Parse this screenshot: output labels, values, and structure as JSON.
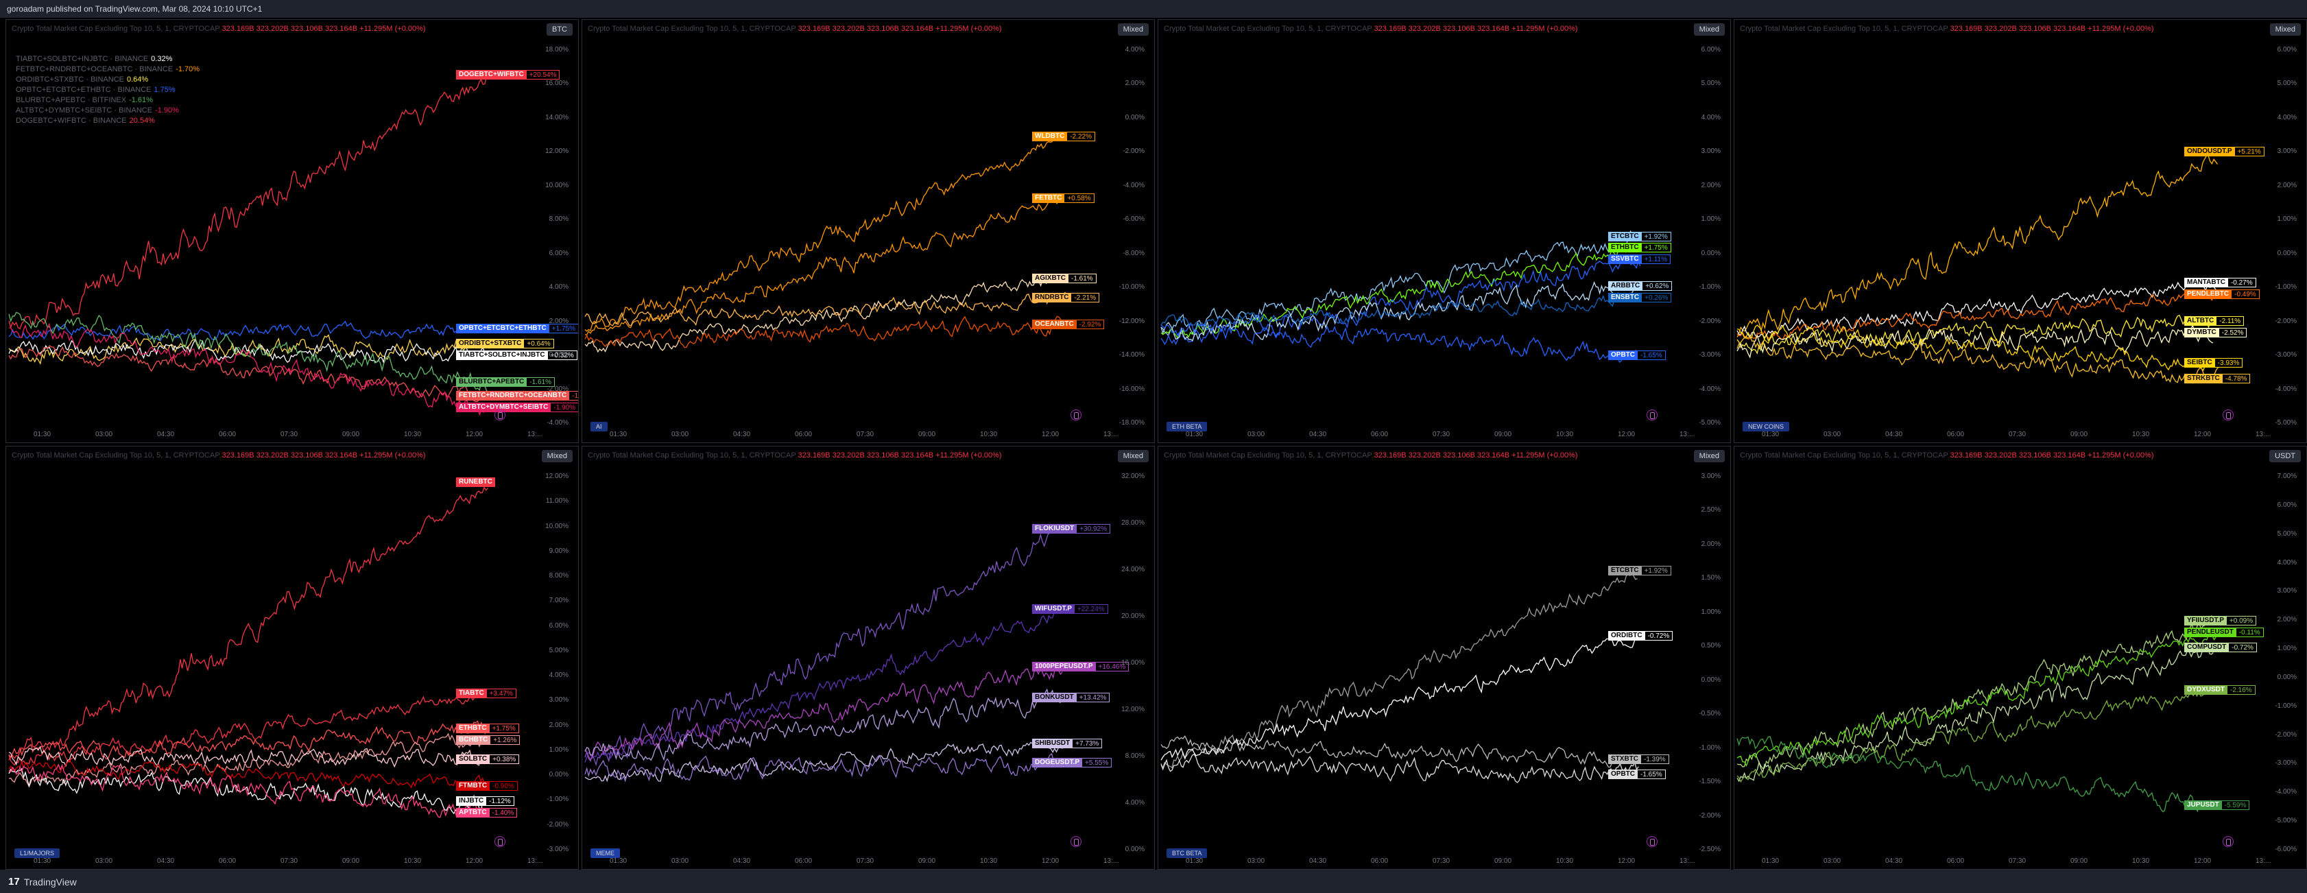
{
  "header": {
    "published": "goroadam published on TradingView.com, Mar 08, 2024 10:10 UTC+1"
  },
  "footer": {
    "brand_logo": "17",
    "brand": "TradingView"
  },
  "panel_title": "Crypto Total Market Cap Excluding Top 10, 5, 1, CRYPTOCAP",
  "panel_values": "323.169B  323.202B  323.106B  323.164B  +11.295M (+0.00%)",
  "time_labels": [
    "01:30",
    "03:00",
    "04:30",
    "06:00",
    "07:30",
    "09:00",
    "10:30",
    "12:00",
    "13:..."
  ],
  "colors": {
    "bg": "#000000",
    "panel_border": "#2a2e39",
    "negative": "#f23645",
    "muted": "#787b86"
  },
  "panels": [
    {
      "id": "p1",
      "scale": "BTC",
      "group": "",
      "legend": [
        {
          "label": "TIABTC+SOLBTC+INJBTC · BINANCE",
          "value": "0.32%",
          "color": "#ffffff"
        },
        {
          "label": "FETBTC+RNDRBTC+OCEANBTC · BINANCE",
          "value": "-1.70%",
          "color": "#ff9800"
        },
        {
          "label": "ORDIBTC+STXBTC · BINANCE",
          "value": "0.64%",
          "color": "#ffeb3b"
        },
        {
          "label": "OPBTC+ETCBTC+ETHBTC · BINANCE",
          "value": "1.75%",
          "color": "#2962ff"
        },
        {
          "label": "BLURBTC+APEBTC · BITFINEX",
          "value": "-1.61%",
          "color": "#4caf50"
        },
        {
          "label": "ALTBTC+DYMBTC+SEIBTC · BINANCE",
          "value": "-1.90%",
          "color": "#e91e63"
        },
        {
          "label": "DOGEBTC+WIFBTC · BINANCE",
          "value": "20.54%",
          "color": "#f23645"
        }
      ],
      "axis": [
        "18.00%",
        "16.00%",
        "14.00%",
        "12.00%",
        "10.00%",
        "8.00%",
        "6.00%",
        "4.00%",
        "2.00%",
        "0.00%",
        "-2.00%",
        "-4.00%"
      ],
      "badges": [
        {
          "sym": "DOGEBTC+WIFBTC",
          "pct": "+20.54%",
          "color": "#f23645"
        },
        {
          "sym": "OPBTC+ETCBTC+ETHBTC",
          "pct": "+1.75%",
          "color": "#2962ff"
        },
        {
          "sym": "ORDIBTC+STXBTC",
          "pct": "+0.64%",
          "color": "#ffd54f"
        },
        {
          "sym": "TIABTC+SOLBTC+INJBTC",
          "pct": "+0.32%",
          "color": "#ffffff"
        },
        {
          "sym": "BLURBTC+APEBTC",
          "pct": "-1.61%",
          "color": "#66bb6a"
        },
        {
          "sym": "FETBTC+RNDRBTC+OCEANBTC",
          "pct": "-1.70%",
          "color": "#ef5350"
        },
        {
          "sym": "ALTBTC+DYMBTC+SEIBTC",
          "pct": "-1.90%",
          "color": "#e91e63"
        }
      ]
    },
    {
      "id": "p2",
      "scale": "Mixed",
      "group": "AI",
      "legend": [],
      "axis": [
        "4.00%",
        "2.00%",
        "0.00%",
        "-2.00%",
        "-4.00%",
        "-6.00%",
        "-8.00%",
        "-10.00%",
        "-12.00%",
        "-14.00%",
        "-16.00%",
        "-18.00%"
      ],
      "badges": [
        {
          "sym": "WLDBTC",
          "pct": "-2.22%",
          "color": "#ff9800"
        },
        {
          "sym": "FETBTC",
          "pct": "+0.58%",
          "color": "#ff9800"
        },
        {
          "sym": "AGIXBTC",
          "pct": "-1.61%",
          "color": "#ffe0b2"
        },
        {
          "sym": "RNDRBTC",
          "pct": "-2.21%",
          "color": "#ffb74d"
        },
        {
          "sym": "OCEANBTC",
          "pct": "-2.92%",
          "color": "#e65100"
        }
      ]
    },
    {
      "id": "p3",
      "scale": "Mixed",
      "group": "ETH BETA",
      "legend": [],
      "axis": [
        "6.00%",
        "5.00%",
        "4.00%",
        "3.00%",
        "2.00%",
        "1.00%",
        "0.00%",
        "-1.00%",
        "-2.00%",
        "-3.00%",
        "-4.00%",
        "-5.00%"
      ],
      "badges": [
        {
          "sym": "ETCBTC",
          "pct": "+1.92%",
          "color": "#90caf9"
        },
        {
          "sym": "ETHBTC",
          "pct": "+1.75%",
          "color": "#76ff03"
        },
        {
          "sym": "SSVBTC",
          "pct": "+1.11%",
          "color": "#2962ff"
        },
        {
          "sym": "ARBBTC",
          "pct": "+0.62%",
          "color": "#bbdefb"
        },
        {
          "sym": "ENSBTC",
          "pct": "+0.26%",
          "color": "#1565c0"
        },
        {
          "sym": "OPBTC",
          "pct": "-1.65%",
          "color": "#2962ff"
        }
      ]
    },
    {
      "id": "p4",
      "scale": "Mixed",
      "group": "NEW COINS",
      "legend": [],
      "axis": [
        "6.00%",
        "5.00%",
        "4.00%",
        "3.00%",
        "2.00%",
        "1.00%",
        "0.00%",
        "-1.00%",
        "-2.00%",
        "-3.00%",
        "-4.00%",
        "-5.00%"
      ],
      "badges": [
        {
          "sym": "ONDOUSDT.P",
          "pct": "+5.21%",
          "color": "#ffb300"
        },
        {
          "sym": "MANTABTC",
          "pct": "-0.27%",
          "color": "#ffffff"
        },
        {
          "sym": "PENDLEBTC",
          "pct": "-0.49%",
          "color": "#ff6d00"
        },
        {
          "sym": "ALTBTC",
          "pct": "-2.11%",
          "color": "#ffeb3b"
        },
        {
          "sym": "DYMBTC",
          "pct": "-2.52%",
          "color": "#fff9c4"
        },
        {
          "sym": "SEIBTC",
          "pct": "-3.93%",
          "color": "#ffd600"
        },
        {
          "sym": "STRKBTC",
          "pct": "-4.78%",
          "color": "#fbc02d"
        }
      ]
    },
    {
      "id": "p5",
      "scale": "Mixed",
      "group": "L1/MAJORS",
      "legend": [],
      "axis": [
        "12.00%",
        "11.00%",
        "10.00%",
        "9.00%",
        "8.00%",
        "7.00%",
        "6.00%",
        "5.00%",
        "4.00%",
        "3.00%",
        "2.00%",
        "1.00%",
        "0.00%",
        "-1.00%",
        "-2.00%",
        "-3.00%"
      ],
      "badges": [
        {
          "sym": "RUNEBTC",
          "pct": "",
          "color": "#f23645"
        },
        {
          "sym": "TIABTC",
          "pct": "+3.47%",
          "color": "#f23645"
        },
        {
          "sym": "ETHBTC",
          "pct": "+1.75%",
          "color": "#ff5252"
        },
        {
          "sym": "BCHBTC",
          "pct": "+1.26%",
          "color": "#ef9a9a"
        },
        {
          "sym": "SOLBTC",
          "pct": "+0.38%",
          "color": "#ffcdd2"
        },
        {
          "sym": "FTMBTC",
          "pct": "-0.90%",
          "color": "#d50000"
        },
        {
          "sym": "INJBTC",
          "pct": "-1.12%",
          "color": "#ffffff"
        },
        {
          "sym": "APTBTC",
          "pct": "-1.40%",
          "color": "#ff4081"
        }
      ]
    },
    {
      "id": "p6",
      "scale": "Mixed",
      "group": "MEME",
      "legend": [],
      "axis": [
        "32.00%",
        "28.00%",
        "24.00%",
        "20.00%",
        "16.00%",
        "12.00%",
        "8.00%",
        "4.00%",
        "0.00%"
      ],
      "badges": [
        {
          "sym": "FLOKIUSDT",
          "pct": "+30.92%",
          "color": "#7e57c2"
        },
        {
          "sym": "WIFUSDT.P",
          "pct": "+22.24%",
          "color": "#5e35b1"
        },
        {
          "sym": "1000PEPEUSDT.P",
          "pct": "+16.46%",
          "color": "#ab47bc"
        },
        {
          "sym": "BONKUSDT",
          "pct": "+13.42%",
          "color": "#b39ddb"
        },
        {
          "sym": "SHIBUSDT",
          "pct": "+7.73%",
          "color": "#d1c4e9"
        },
        {
          "sym": "DOGEUSDT.P",
          "pct": "+5.55%",
          "color": "#9575cd"
        }
      ]
    },
    {
      "id": "p7",
      "scale": "Mixed",
      "group": "BTC BETA",
      "legend": [],
      "axis": [
        "3.00%",
        "2.50%",
        "2.00%",
        "1.50%",
        "1.00%",
        "0.50%",
        "0.00%",
        "-0.50%",
        "-1.00%",
        "-1.50%",
        "-2.00%",
        "-2.50%"
      ],
      "badges": [
        {
          "sym": "ETCBTC",
          "pct": "+1.92%",
          "color": "#9e9e9e"
        },
        {
          "sym": "ORDIBTC",
          "pct": "-0.72%",
          "color": "#ffffff"
        },
        {
          "sym": "STXBTC",
          "pct": "-1.39%",
          "color": "#bdbdbd"
        },
        {
          "sym": "OPBTC",
          "pct": "-1.65%",
          "color": "#e0e0e0"
        }
      ]
    },
    {
      "id": "p8",
      "scale": "USDT",
      "group": "",
      "legend": [],
      "axis": [
        "7.00%",
        "6.00%",
        "5.00%",
        "4.00%",
        "3.00%",
        "2.00%",
        "1.00%",
        "0.00%",
        "-1.00%",
        "-2.00%",
        "-3.00%",
        "-4.00%",
        "-5.00%",
        "-6.00%"
      ],
      "badges": [
        {
          "sym": "YFIIUSDT.P",
          "pct": "+0.09%",
          "color": "#aed581"
        },
        {
          "sym": "PENDLEUSDT",
          "pct": "-0.11%",
          "color": "#64dd17"
        },
        {
          "sym": "COMPUSDT",
          "pct": "-0.72%",
          "color": "#c5e1a5"
        },
        {
          "sym": "DYDXUSDT",
          "pct": "-2.16%",
          "color": "#7cb342"
        },
        {
          "sym": "JUPUSDT",
          "pct": "-5.59%",
          "color": "#43a047"
        }
      ]
    }
  ]
}
